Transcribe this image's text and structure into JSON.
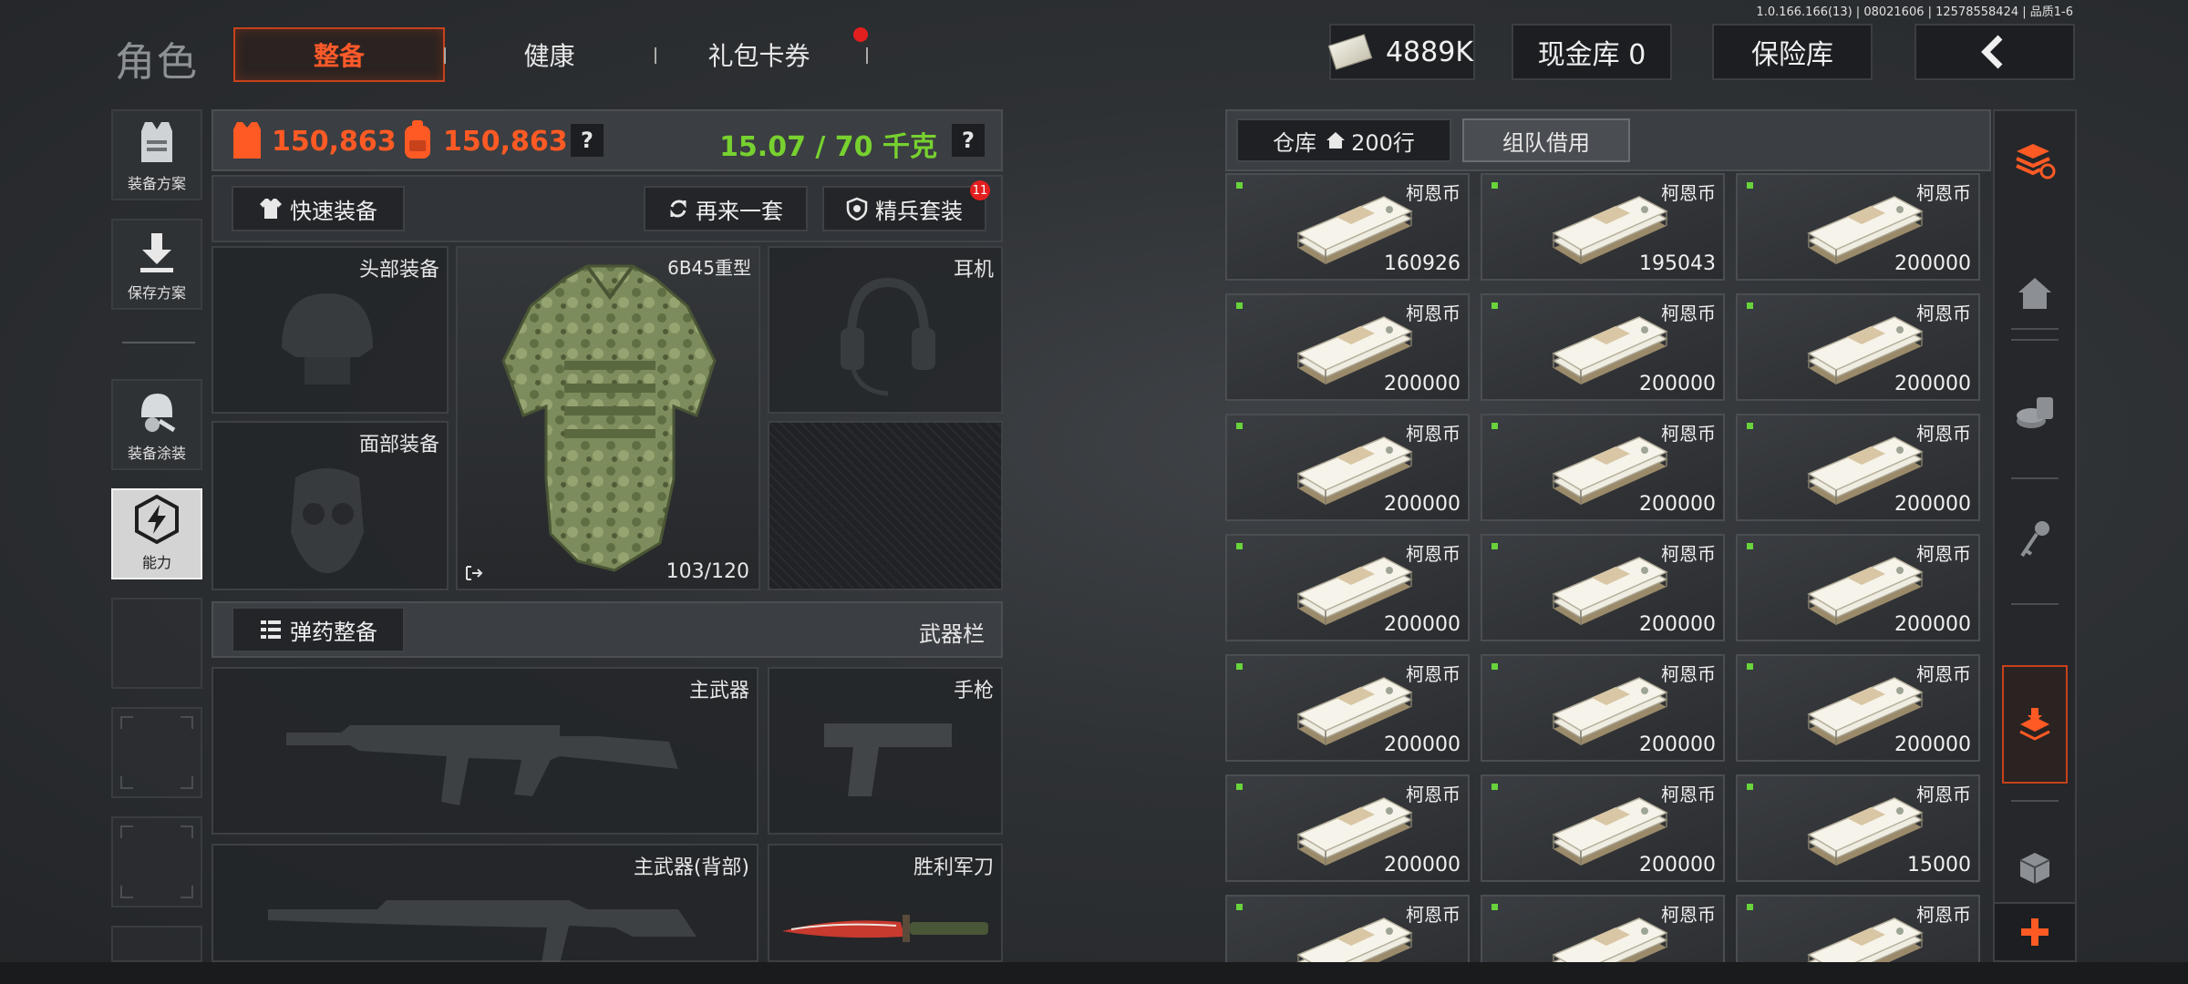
{
  "version_text": "1.0.166.166(13) | 08021606 | 12578558424 | 品质1-6",
  "page_title": "角色",
  "tabs": [
    {
      "label": "整备",
      "active": true
    },
    {
      "label": "健康",
      "active": false
    },
    {
      "label": "礼包卡券",
      "active": false,
      "has_notification": true
    }
  ],
  "header": {
    "money": "4889K",
    "cash_vault": "现金库 0",
    "insurance_vault": "保险库"
  },
  "sidebar": [
    {
      "label": "装备方案",
      "icon": "vest-icon"
    },
    {
      "label": "保存方案",
      "icon": "download-icon"
    },
    {
      "label": "装备涂装",
      "icon": "helmet-paint-icon"
    },
    {
      "label": "能力",
      "icon": "lightning-hex-icon",
      "active": true
    }
  ],
  "stats": {
    "armor_value": "150,863",
    "backpack_value": "150,863",
    "weight": "15.07 / 70 千克"
  },
  "actions": {
    "quick_equip": "快速装备",
    "repeat_set": "再来一套",
    "elite_set": "精兵套装",
    "elite_badge": "11"
  },
  "slots": {
    "head": "头部装备",
    "face": "面部装备",
    "armor_name": "6B45重型",
    "armor_durability": "103/120",
    "headset": "耳机"
  },
  "weapons": {
    "ammo_button": "弹药整备",
    "section_label": "武器栏",
    "primary": "主武器",
    "pistol": "手枪",
    "primary_back": "主武器(背部)",
    "knife": "胜利军刀"
  },
  "inventory": {
    "warehouse_tab": "仓库",
    "warehouse_rows": "200行",
    "team_borrow_tab": "组队借用",
    "item_name": "柯恩币",
    "items": [
      {
        "name": "柯恩币",
        "qty": "160926"
      },
      {
        "name": "柯恩币",
        "qty": "195043"
      },
      {
        "name": "柯恩币",
        "qty": "200000"
      },
      {
        "name": "柯恩币",
        "qty": "200000"
      },
      {
        "name": "柯恩币",
        "qty": "200000"
      },
      {
        "name": "柯恩币",
        "qty": "200000"
      },
      {
        "name": "柯恩币",
        "qty": "200000"
      },
      {
        "name": "柯恩币",
        "qty": "200000"
      },
      {
        "name": "柯恩币",
        "qty": "200000"
      },
      {
        "name": "柯恩币",
        "qty": "200000"
      },
      {
        "name": "柯恩币",
        "qty": "200000"
      },
      {
        "name": "柯恩币",
        "qty": "200000"
      },
      {
        "name": "柯恩币",
        "qty": "200000"
      },
      {
        "name": "柯恩币",
        "qty": "200000"
      },
      {
        "name": "柯恩币",
        "qty": "200000"
      },
      {
        "name": "柯恩币",
        "qty": "200000"
      },
      {
        "name": "柯恩币",
        "qty": "200000"
      },
      {
        "name": "柯恩币",
        "qty": "15000"
      },
      {
        "name": "柯恩币",
        "qty": ""
      },
      {
        "name": "柯恩币",
        "qty": ""
      },
      {
        "name": "柯恩币",
        "qty": ""
      }
    ]
  },
  "rail_icons": [
    "stack-refresh-icon",
    "home-icon",
    "coins-icon",
    "key-icon",
    "collect-icon",
    "box-icon",
    "plus-icon"
  ],
  "colors": {
    "accent": "#ff5a24",
    "weight_ok": "#77d12f",
    "new_dot": "#68d33b",
    "notification": "#e21f1f"
  }
}
